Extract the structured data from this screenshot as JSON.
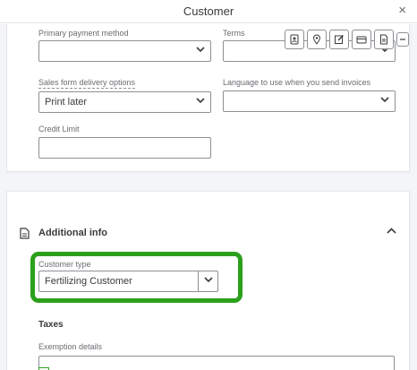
{
  "window": {
    "title": "Customer",
    "close_glyph": "×"
  },
  "payment": {
    "primary_payment_method": {
      "label": "Primary payment method",
      "value": ""
    },
    "terms": {
      "label": "Terms",
      "value": ""
    },
    "delivery": {
      "label": "Sales form delivery options",
      "value": "Print later"
    },
    "language": {
      "label": "Language to use when you send invoices",
      "value": ""
    },
    "credit_limit": {
      "label": "Credit Limit",
      "value": ""
    }
  },
  "toolbar": {
    "icons": [
      "contact-card-icon",
      "location-pin-icon",
      "edit-note-icon",
      "payment-card-icon",
      "document-icon",
      "collapse-minus-icon"
    ]
  },
  "additional_info": {
    "title": "Additional info",
    "icon": "document-icon",
    "chevron": "chevron-up-icon",
    "customer_type": {
      "label": "Customer type",
      "value": "Fertilizing Customer"
    },
    "taxes_heading": "Taxes",
    "exemption": {
      "label": "Exemption details",
      "value": ""
    }
  },
  "colors": {
    "highlight": "#2ca01c",
    "text": "#393a3d",
    "muted": "#6b6c72",
    "border": "#8d9096",
    "background": "#f4f5f8"
  },
  "chevron_down_glyph": "⌄",
  "chevron_up_glyph": "⌃"
}
